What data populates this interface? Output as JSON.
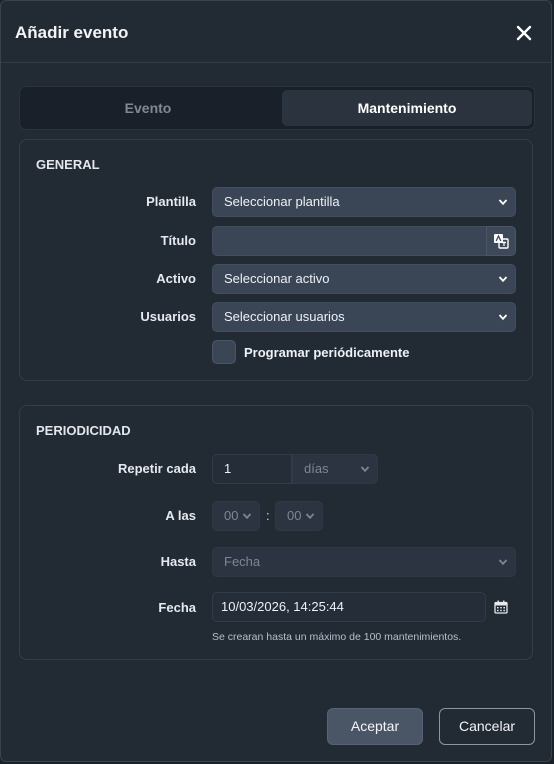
{
  "modal": {
    "title": "Añadir evento"
  },
  "tabs": [
    {
      "label": "Evento",
      "active": false
    },
    {
      "label": "Mantenimiento",
      "active": true
    }
  ],
  "general": {
    "title": "GENERAL",
    "plantilla": {
      "label": "Plantilla",
      "value": "Seleccionar plantilla"
    },
    "titulo": {
      "label": "Título",
      "value": ""
    },
    "activo": {
      "label": "Activo",
      "value": "Seleccionar activo"
    },
    "usuarios": {
      "label": "Usuarios",
      "value": "Seleccionar usuarios"
    },
    "periodic": {
      "label": "Programar periódicamente",
      "checked": false
    }
  },
  "periodicidad": {
    "title": "PERIODICIDAD",
    "repetir": {
      "label": "Repetir cada",
      "value": "1",
      "unit": "días"
    },
    "a_las": {
      "label": "A las",
      "hour": "00",
      "minute": "00",
      "separator": ":"
    },
    "hasta": {
      "label": "Hasta",
      "value": "Fecha"
    },
    "fecha": {
      "label": "Fecha",
      "value": "10/03/2026, 14:25:44"
    },
    "help": "Se crearan hasta un máximo de 100 mantenimientos."
  },
  "footer": {
    "accept": "Aceptar",
    "cancel": "Cancelar"
  },
  "icons": {
    "close": "close-icon",
    "translate": "translate-icon",
    "calendar": "calendar-icon",
    "chevron": "chevron-down-icon"
  }
}
